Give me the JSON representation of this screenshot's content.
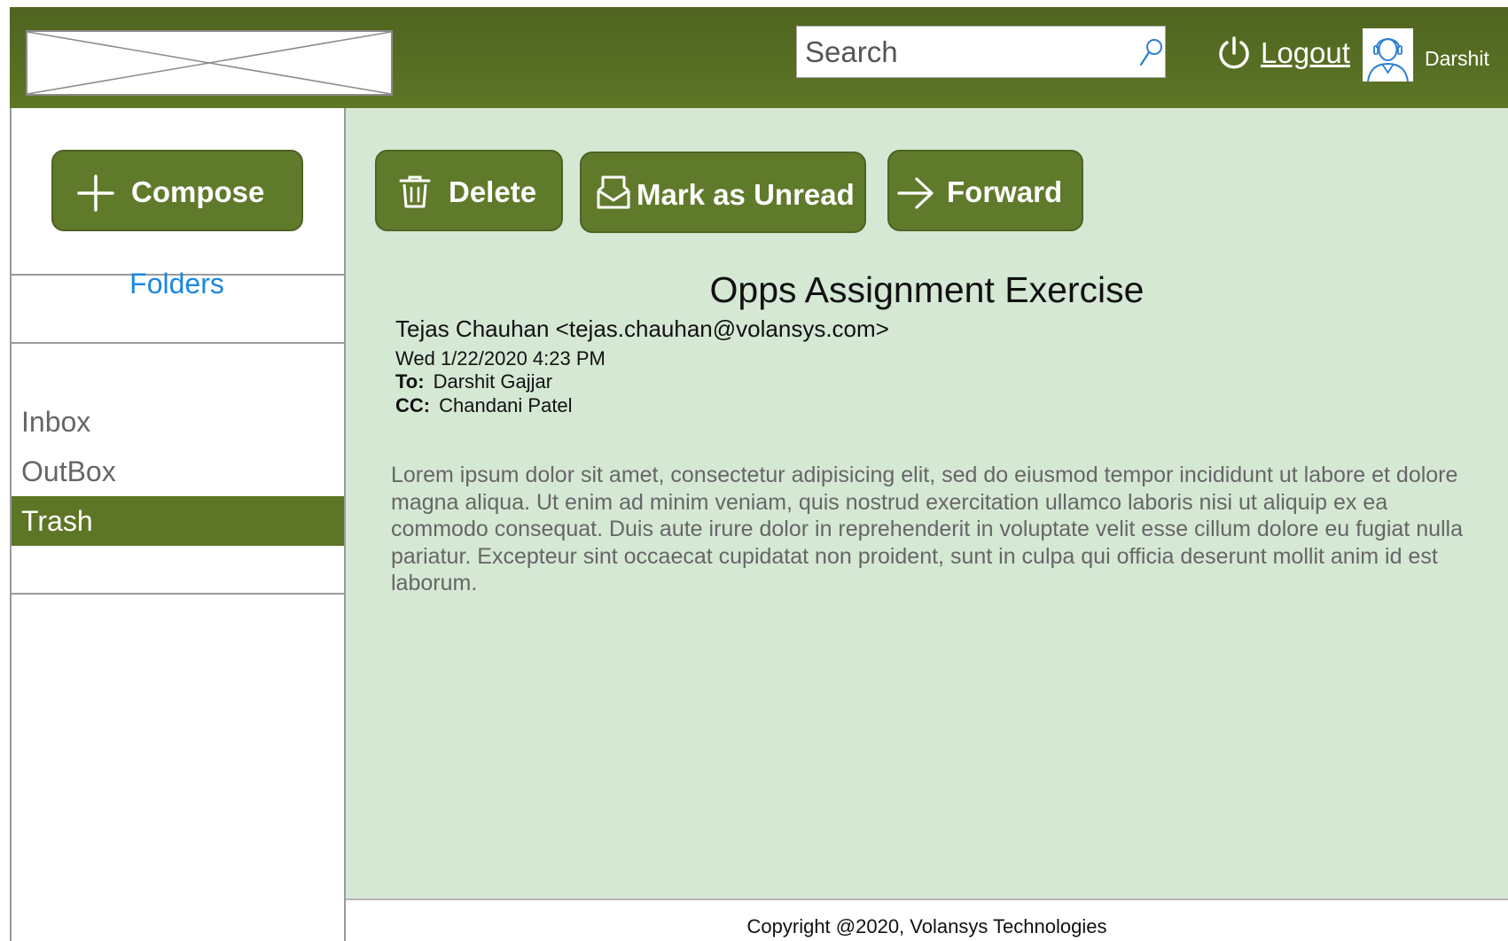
{
  "header": {
    "search": {
      "placeholder": "Search",
      "value": ""
    },
    "logout_label": "Logout",
    "user_name": "Darshit"
  },
  "sidebar": {
    "compose_label": "Compose",
    "folders_heading": "Folders",
    "folders": [
      {
        "label": "Inbox",
        "active": false
      },
      {
        "label": "OutBox",
        "active": false
      },
      {
        "label": "Trash",
        "active": true
      }
    ]
  },
  "toolbar": {
    "delete_label": "Delete",
    "mark_unread_label": "Mark as Unread",
    "forward_label": "Forward"
  },
  "email": {
    "subject": "Opps Assignment Exercise",
    "from": "Tejas Chauhan <tejas.chauhan@volansys.com>",
    "date": "Wed 1/22/2020 4:23 PM",
    "to_label": "To:",
    "to": "Darshit Gajjar",
    "cc_label": "CC:",
    "cc": "Chandani Patel",
    "body": "Lorem ipsum dolor sit amet, consectetur adipisicing elit, sed do eiusmod tempor incididunt ut labore et dolore magna aliqua. Ut enim ad minim veniam, quis nostrud exercitation ullamco laboris nisi ut aliquip ex ea commodo consequat. Duis aute irure dolor in reprehenderit in voluptate velit esse cillum dolore eu fugiat nulla pariatur. Excepteur sint occaecat cupidatat non proident, sunt in culpa qui officia deserunt mollit anim id est laborum."
  },
  "footer": {
    "copyright": "Copyright @2020, Volansys Technologies"
  },
  "colors": {
    "header_green": "#5c7626",
    "button_green": "#607a2c",
    "content_background": "#d5e8d4",
    "folders_heading_blue": "#1a87e0"
  },
  "icons": {
    "search": "search-icon",
    "logout": "power-icon",
    "user": "avatar-icon",
    "compose": "plus-icon",
    "delete": "trash-icon",
    "mark_unread": "envelope-icon",
    "forward": "arrow-right-icon",
    "logo": "image-placeholder-icon"
  }
}
